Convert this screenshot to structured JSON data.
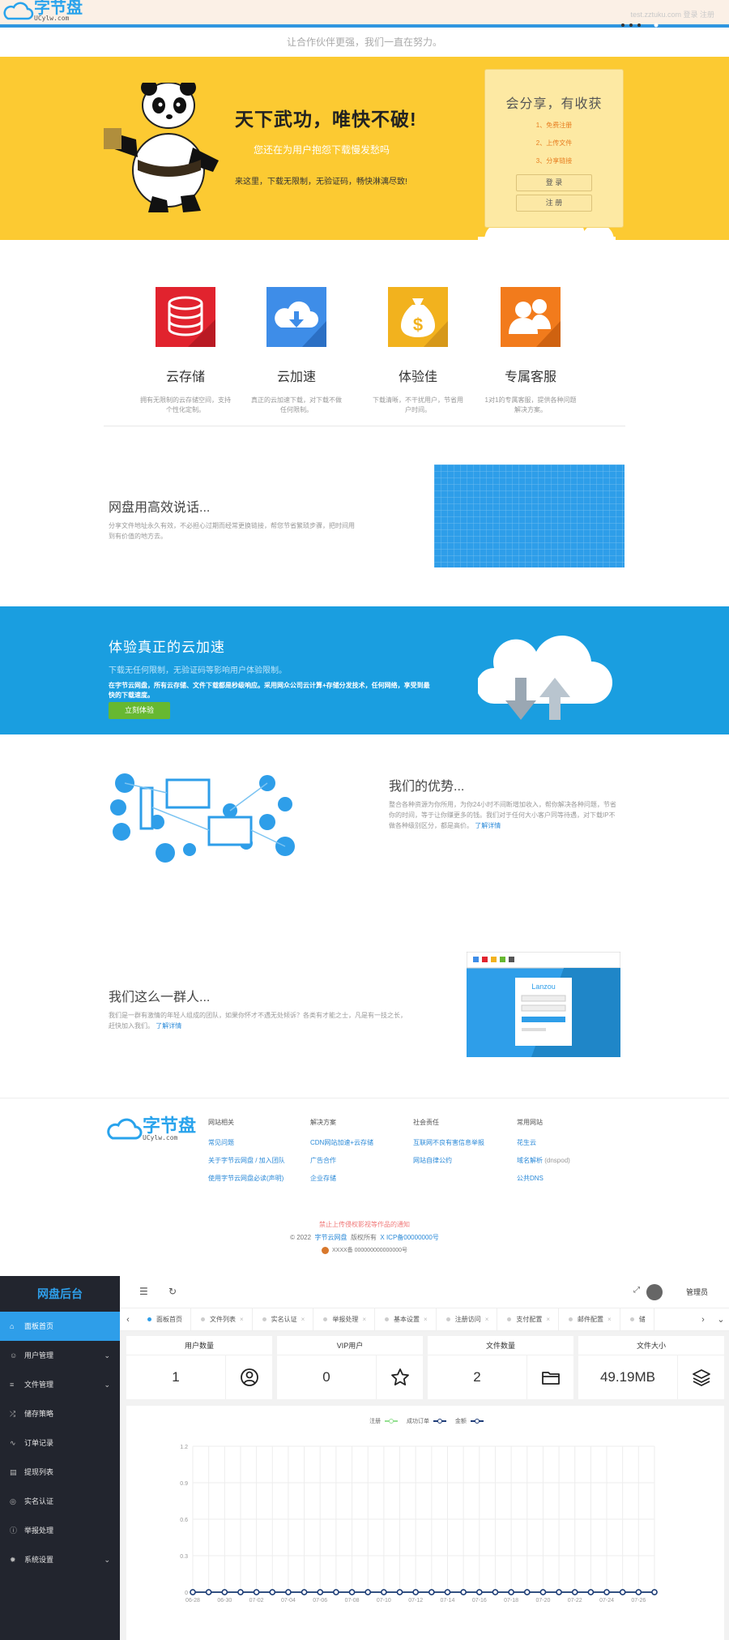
{
  "header": {
    "logo_text": "字节盘",
    "logo_sub": "UCylw.com",
    "right_links": "test.zztuku.com 登录 注册"
  },
  "slogan": "让合作伙伴更强，我们一直在努力。",
  "hero": {
    "title": "天下武功，唯快不破!",
    "subtitle": "您还在为用户抱怨下载慢发愁吗",
    "desc": "来这里，下载无限制，无验证码，畅快淋漓尽致!",
    "box_title": "会分享，有收获",
    "steps": [
      "1、免费注册",
      "2、上传文件",
      "3、分享链接"
    ],
    "login_btn": "登 录",
    "register_btn": "注 册"
  },
  "features": [
    {
      "name": "云存储",
      "desc": "拥有无限制的云存储空间，支持个性化定制。",
      "icon": "database-icon",
      "color": "#e1232e"
    },
    {
      "name": "云加速",
      "desc": "真正的云加速下载，对下载不做任何限制。",
      "icon": "cloud-download-icon",
      "color": "#3e8de8"
    },
    {
      "name": "体验佳",
      "desc": "下载清晰，不干扰用户，节省用户时间。",
      "icon": "money-bag-icon",
      "color": "#f2b21e"
    },
    {
      "name": "专属客服",
      "desc": "1对1的专属客服，提供各种问题解决方案。",
      "icon": "users-icon",
      "color": "#f27b1c"
    }
  ],
  "sec1": {
    "title": "网盘用高效说话...",
    "desc": "分享文件地址永久有效，不必担心过期而经常更换链接，帮您节省繁琐步骤，把时间用到有价值的地方去。"
  },
  "blue": {
    "title": "体验真正的云加速",
    "sub": "下载无任何限制，无验证码等影响用户体验限制。",
    "desc": "在字节云网盘，所有云存储、文件下载都是秒级响应。采用网众公司云计算+存储分发技术，任何网络，享受到最快的下载速度。",
    "button": "立刻体验"
  },
  "sec2": {
    "title": "我们的优势...",
    "desc": "整合各种资源为你所用，为你24小时不间断增加收入，帮你解决各种问题，节省你的时间，等于让你赚更多的钱。我们对于任何大小客户同等待遇，对下载IP不做各种级别区分，都是高价。",
    "more": "了解详情"
  },
  "sec3": {
    "title": "我们这么一群人...",
    "desc": "我们是一群有激情的年轻人组成的团队，如果你怀才不遇无处倾诉？各类有才能之士，凡是有一技之长，赶快加入我们。",
    "more": "了解详情",
    "mock_label": "Lanzou"
  },
  "footer": {
    "cols": [
      {
        "title": "网站相关",
        "links": [
          "常见问题",
          "关于字节云网盘 / 加入团队",
          "使用字节云网盘必读(声明)"
        ]
      },
      {
        "title": "解决方案",
        "links": [
          "CDN网站加速+云存储",
          "广告合作",
          "企业存储"
        ]
      },
      {
        "title": "社会责任",
        "links": [
          "互联网不良有害信息举报",
          "网站自律公约"
        ]
      },
      {
        "title": "常用网站",
        "links": [
          "花生云",
          "域名解析",
          "公共DNS"
        ],
        "note": "(dnspod)"
      }
    ],
    "warning": "禁止上传侵权影视等作品的通知",
    "copyright": "© 2022",
    "site": "字节云网盘",
    "rights": "版权所有",
    "icp": "X ICP备00000000号",
    "police": "XXXX备 000000000000000号"
  },
  "admin": {
    "title": "网盘后台",
    "menu": [
      {
        "label": "面板首页",
        "icon": "home-icon",
        "active": true,
        "arrow": false
      },
      {
        "label": "用户管理",
        "icon": "user-icon",
        "active": false,
        "arrow": true
      },
      {
        "label": "文件管理",
        "icon": "file-icon",
        "active": false,
        "arrow": true
      },
      {
        "label": "储存策略",
        "icon": "storage-icon",
        "active": false,
        "arrow": false
      },
      {
        "label": "订单记录",
        "icon": "order-icon",
        "active": false,
        "arrow": false
      },
      {
        "label": "提现列表",
        "icon": "cash-icon",
        "active": false,
        "arrow": false
      },
      {
        "label": "实名认证",
        "icon": "verify-icon",
        "active": false,
        "arrow": false
      },
      {
        "label": "举报处理",
        "icon": "report-icon",
        "active": false,
        "arrow": false
      },
      {
        "label": "系统设置",
        "icon": "settings-icon",
        "active": false,
        "arrow": true
      }
    ],
    "user": "管理员",
    "tabs": [
      "面板首页",
      "文件列表",
      "实名认证",
      "举报处理",
      "基本设置",
      "注册访问",
      "支付配置",
      "邮件配置",
      "储"
    ],
    "cards": [
      {
        "title": "用户数量",
        "value": "1",
        "icon": "user-circle-icon"
      },
      {
        "title": "VIP用户",
        "value": "0",
        "icon": "star-icon"
      },
      {
        "title": "文件数量",
        "value": "2",
        "icon": "folder-icon"
      },
      {
        "title": "文件大小",
        "value": "49.19MB",
        "icon": "layers-icon"
      }
    ]
  },
  "chart_data": {
    "type": "line",
    "legend": [
      "注册",
      "成功订单",
      "金额"
    ],
    "colors": [
      "#95e092",
      "#1e3c78",
      "#1e3c78"
    ],
    "x": [
      "06-28",
      "06-29",
      "06-30",
      "07-01",
      "07-02",
      "07-03",
      "07-04",
      "07-05",
      "07-06",
      "07-07",
      "07-08",
      "07-09",
      "07-10",
      "07-11",
      "07-12",
      "07-13",
      "07-14",
      "07-15",
      "07-16",
      "07-17",
      "07-18",
      "07-19",
      "07-20",
      "07-21",
      "07-22",
      "07-23",
      "07-24",
      "07-25",
      "07-26",
      "07-27"
    ],
    "x_tick_labels": [
      "06-28",
      "06-30",
      "07-02",
      "07-04",
      "07-06",
      "07-08",
      "07-10",
      "07-12",
      "07-14",
      "07-16",
      "07-18",
      "07-20",
      "07-22",
      "07-24",
      "07-26"
    ],
    "yticks": [
      "0",
      "0.3",
      "0.6",
      "0.9",
      "1.2"
    ],
    "ylim": [
      0,
      1.2
    ],
    "series": [
      {
        "name": "注册",
        "values": [
          0,
          0,
          0,
          0,
          0,
          0,
          0,
          0,
          0,
          0,
          0,
          0,
          0,
          0,
          0,
          0,
          0,
          0,
          0,
          0,
          0,
          0,
          0,
          0,
          0,
          0,
          0,
          0,
          0,
          0
        ]
      },
      {
        "name": "成功订单",
        "values": [
          0,
          0,
          0,
          0,
          0,
          0,
          0,
          0,
          0,
          0,
          0,
          0,
          0,
          0,
          0,
          0,
          0,
          0,
          0,
          0,
          0,
          0,
          0,
          0,
          0,
          0,
          0,
          0,
          0,
          0
        ]
      },
      {
        "name": "金额",
        "values": [
          0,
          0,
          0,
          0,
          0,
          0,
          0,
          0,
          0,
          0,
          0,
          0,
          0,
          0,
          0,
          0,
          0,
          0,
          0,
          0,
          0,
          0,
          0,
          0,
          0,
          0,
          0,
          0,
          0,
          0
        ]
      }
    ]
  }
}
